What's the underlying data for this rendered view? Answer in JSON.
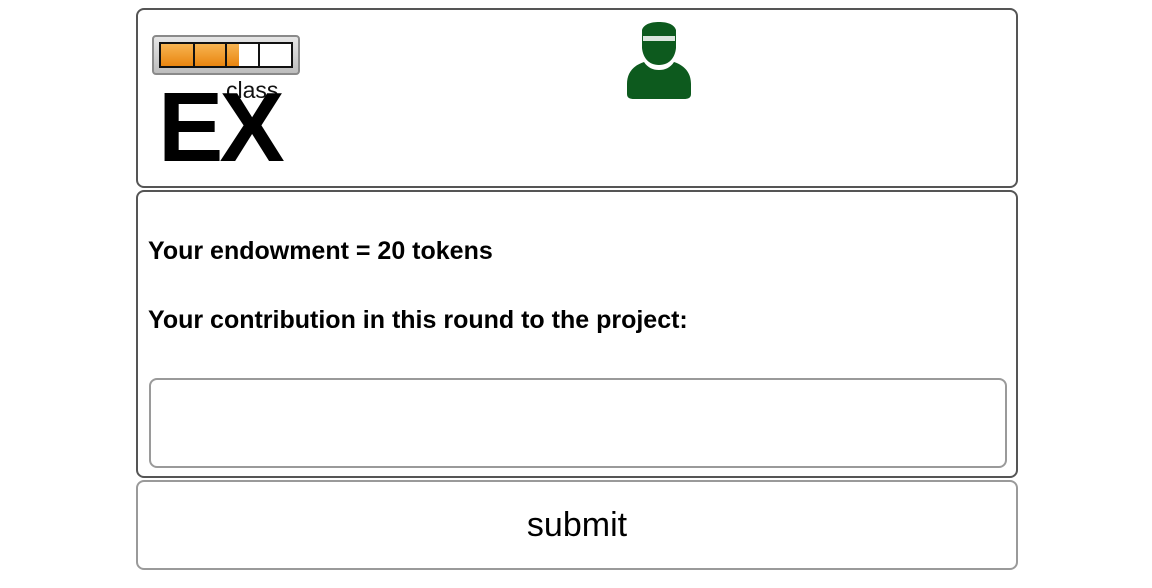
{
  "header": {
    "logo": {
      "text_small": "class",
      "text_large": "EX",
      "progress_fraction": 0.6,
      "progress_segments": 4,
      "progress_color": "#e9850f"
    },
    "avatar": {
      "icon": "user-icon",
      "color": "#0d5a1e"
    }
  },
  "form": {
    "endowment_text": "Your endowment = 20 tokens",
    "contribution_label": "Your contribution in this round to the project:",
    "contribution_value": "",
    "contribution_placeholder": ""
  },
  "submit": {
    "label": "submit"
  }
}
